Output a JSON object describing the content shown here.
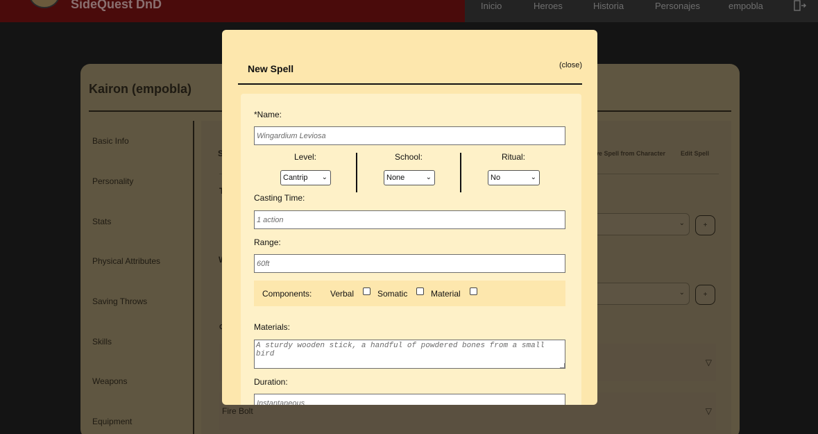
{
  "app": {
    "brand": "SideQuest DnD"
  },
  "nav": {
    "items": [
      "Inicio",
      "Heroes",
      "Historia",
      "Personajes",
      "empobla"
    ]
  },
  "character": {
    "title": "Kairon (empobla)",
    "sidebar": [
      "Basic Info",
      "Personality",
      "Stats",
      "Physical Attributes",
      "Saving Throws",
      "Skills",
      "Weapons",
      "Equipment"
    ],
    "links": {
      "remove_spell": "ve Spell from Character",
      "edit_spell": "Edit Spell"
    },
    "plus_label": "+",
    "frag_s": "S",
    "frag_t": "T",
    "frag_w": "W",
    "frag_c": "C",
    "fire_bolt": "Fire Bolt"
  },
  "modal": {
    "title": "New Spell",
    "close_label": "(close)",
    "name_label": "*Name:",
    "name_placeholder": "Wingardium Leviosa",
    "level_label": "Level:",
    "level_value": "Cantrip",
    "school_label": "School:",
    "school_value": "None",
    "ritual_label": "Ritual:",
    "ritual_value": "No",
    "casting_label": "Casting Time:",
    "casting_placeholder": "1 action",
    "range_label": "Range:",
    "range_placeholder": "60ft",
    "components_label": "Components:",
    "verbal_label": "Verbal",
    "somatic_label": "Somatic",
    "material_label": "Material",
    "materials_label": "Materials:",
    "materials_placeholder": "A sturdy wooden stick, a handful of powdered bones from a small bird",
    "duration_label": "Duration:",
    "duration_placeholder": "Instantaneous"
  }
}
